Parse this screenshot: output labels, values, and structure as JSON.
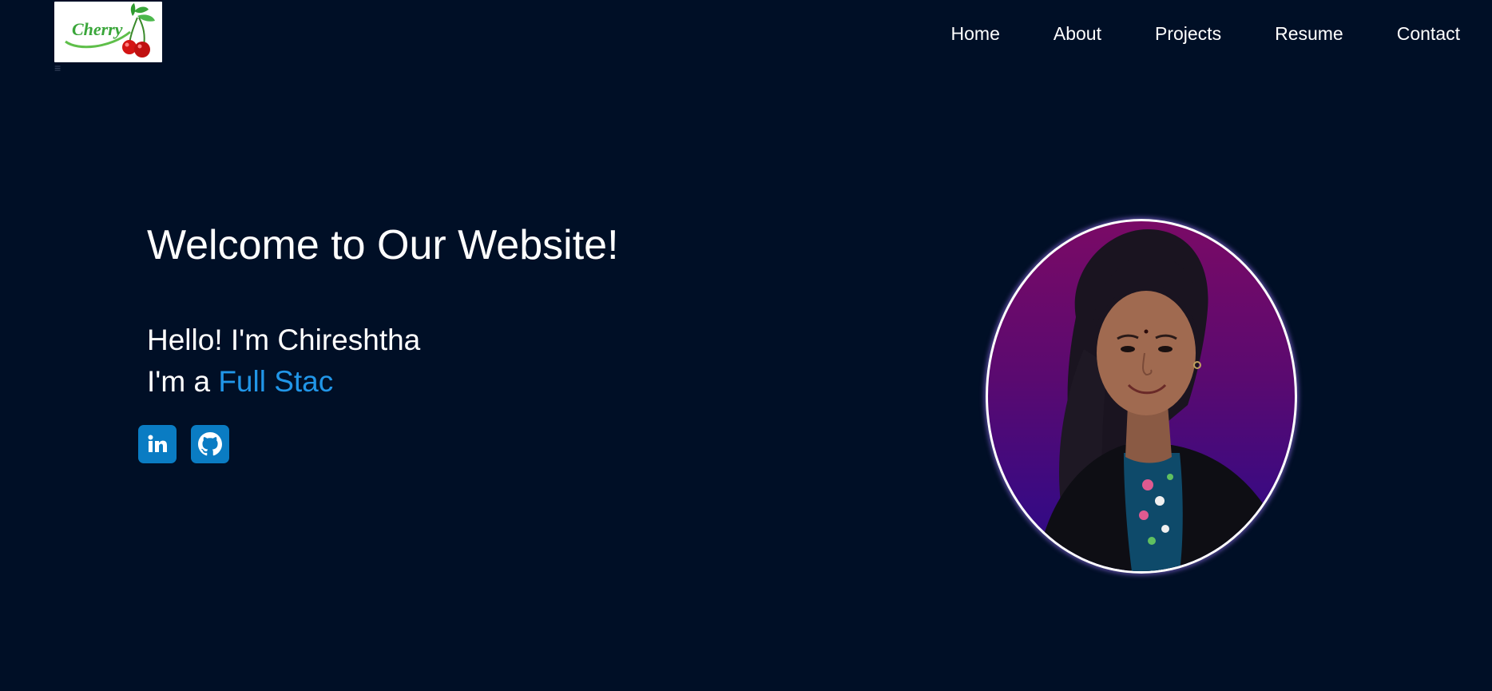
{
  "brand": {
    "logo_text": "Cherry"
  },
  "nav": {
    "items": [
      "Home",
      "About",
      "Projects",
      "Resume",
      "Contact"
    ]
  },
  "hero": {
    "title": "Welcome to Our Website!",
    "hello": "Hello! I'm Chireshtha",
    "role_prefix": "I'm a ",
    "role_typed": "Full Stac"
  },
  "socials": {
    "icons": [
      "linkedin-icon",
      "github-icon"
    ]
  },
  "colors": {
    "background": "#000f26",
    "accent_text": "#2196e8",
    "social_button": "#0a7cc3",
    "portrait_bg_top": "#7a0a66",
    "portrait_bg_bottom": "#2a0a86"
  }
}
